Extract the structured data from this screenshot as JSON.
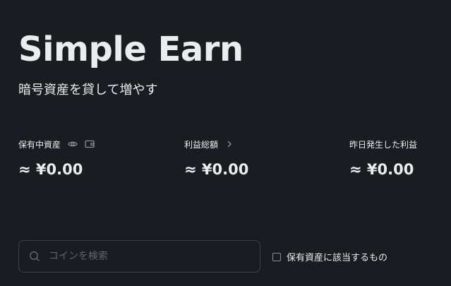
{
  "hero": {
    "title": "Simple Earn",
    "subtitle": "暗号資産を貸して増やす"
  },
  "stats": [
    {
      "label": "保有中資産",
      "value": "≈ ¥0.00",
      "icons": [
        "eye-icon",
        "wallet-icon"
      ]
    },
    {
      "label": "利益総額",
      "value": "≈ ¥0.00",
      "icons": [
        "chevron-right-icon"
      ]
    },
    {
      "label": "昨日発生した利益",
      "value": "≈ ¥0.00",
      "icons": []
    }
  ],
  "search": {
    "placeholder": "コインを検索",
    "value": "",
    "icon": "search-icon"
  },
  "filter": {
    "label": "保有資産に該当するもの",
    "checked": false
  },
  "colors": {
    "background": "#1b1c21",
    "text": "#eaecef",
    "muted": "#848e9c",
    "border": "#3c4048"
  }
}
